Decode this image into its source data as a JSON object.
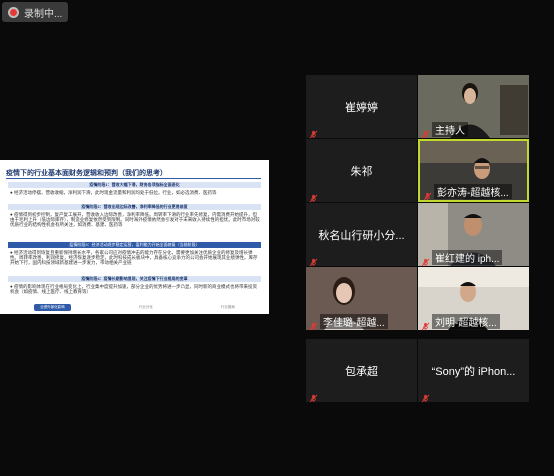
{
  "recording": {
    "label": "录制中..."
  },
  "slide": {
    "title": "疫情下的行业基本面财务逻辑和预判（我们的思考）",
    "stages": [
      {
        "tag": "疫情阶段1：营收大幅下滑，财务各项指标全面恶化",
        "text": "● 经济活动停摆，营收收缩，净利润下滑，此时现金流量和利润均处于低位。行业，如必选消费、医药等"
      },
      {
        "tag": "疫情阶段2：营收出现边际改善，净利率降低的行业更易修复",
        "text": "● 疫情得到初步控制，复产复工展开，营收收入边际改善，净利率降低。周转率下滑的行业率先修复，内需消费开始提升，但由于毛利上升（低边际库存），制造业修复依然受到限制。同时海外疫情依然会引发对于未来收入持续性的担忧。此时市场对较优质行业的结构性机会有所关注，如消费、基建、医药等"
      },
      {
        "tag": "疫情阶段3：经济活动逐步稳定运营，盈利能力开始全面修复（当前阶段）",
        "text": "● 经济活动得到恢复且重新保持增长水平，各家公司应对疫情冲击的能力存在分化，需要更加关注优质企业的修复及增长弹性。周转率改善，利润修复，经济恢复逐步稳定，此时科技成长板块中，具备核心竞争力的公司会开始展现其业绩弹性。库存开始下行，国内科技领域新基建进一步发力，带动相关产业链"
      },
      {
        "tag": "疫情阶段4：疫情长期影响显现，关注疫情下行业格局的变革",
        "text": "● 疫情的影响体现在行业格局变化上，行业集中度提升加速，部分企业的优势将进一步凸显，同时新的商业模式也将带来投资机会（如疫情、线上医疗、线上教育等）"
      }
    ],
    "band": "● 经济活动逐步修复正常，盈利能力开始全面修复（当前阶段）",
    "footer": [
      "业绩外部化影响",
      "行业分化",
      "行业格局"
    ]
  },
  "participants": [
    {
      "name": "崔婷婷",
      "label": "",
      "video": false
    },
    {
      "name": "",
      "label": "主持人",
      "video": true,
      "scene": "host"
    },
    {
      "name": "朱祁",
      "label": "",
      "video": false
    },
    {
      "name": "",
      "label": "彭亦涛-超越核...",
      "video": true,
      "scene": "man1",
      "active": true
    },
    {
      "name": "秋名山行研小分...",
      "label": "",
      "video": false
    },
    {
      "name": "",
      "label": "崔红建的 iph...",
      "video": true,
      "scene": "man2"
    },
    {
      "name": "",
      "label": "李佳璐-超越...",
      "video": true,
      "scene": "woman2"
    },
    {
      "name": "",
      "label": "刘明-超越核...",
      "video": true,
      "scene": "man3"
    },
    {
      "name": "包承超",
      "label": "",
      "video": false
    },
    {
      "name": "“Sony”的 iPhon...",
      "label": "",
      "video": false
    }
  ],
  "colors": {
    "active_border": "#c4d92e",
    "muted_mic": "#e53935",
    "tile_bg": "#1d1d1d"
  }
}
